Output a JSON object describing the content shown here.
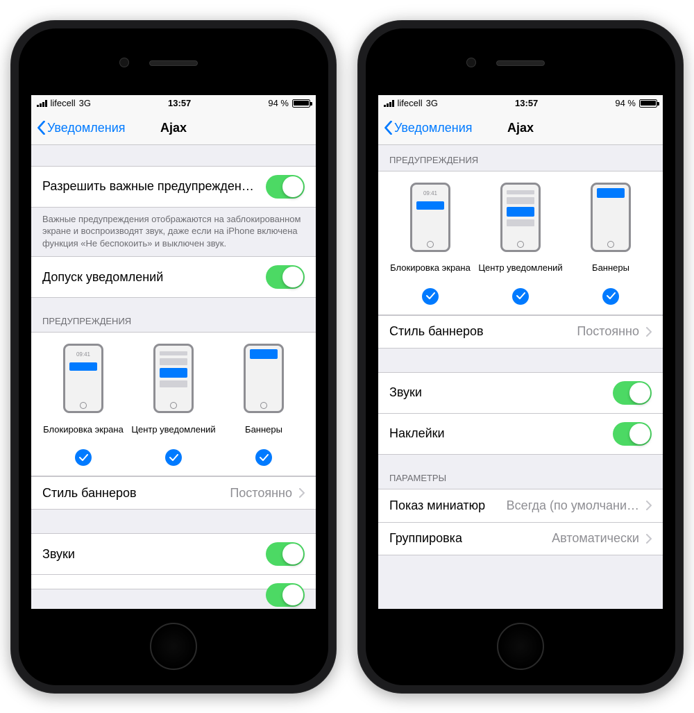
{
  "status": {
    "carrier": "lifecell",
    "network": "3G",
    "time": "13:57",
    "battery_pct": "94 %"
  },
  "nav": {
    "back": "Уведомления",
    "title": "Ajax"
  },
  "left": {
    "critical_label": "Разрешить важные предупрежден…",
    "critical_footer": "Важные предупреждения отображаются на заблокированном экране и воспроизводят звук, даже если на iPhone включена функция «Не беспокоить» и выключен звук.",
    "allow_label": "Допуск уведомлений",
    "alerts_header": "ПРЕДУПРЕЖДЕНИЯ",
    "banner_style_label": "Стиль баннеров",
    "banner_style_value": "Постоянно",
    "sounds_label": "Звуки"
  },
  "right": {
    "alerts_header": "ПРЕДУПРЕЖДЕНИЯ",
    "banner_style_label": "Стиль баннеров",
    "banner_style_value": "Постоянно",
    "sounds_label": "Звуки",
    "badges_label": "Наклейки",
    "options_header": "ПАРАМЕТРЫ",
    "previews_label": "Показ миниатюр",
    "previews_value": "Всегда (по умолчани…",
    "grouping_label": "Группировка",
    "grouping_value": "Автоматически"
  },
  "preview": {
    "time": "09:41",
    "lock": "Блокировка экрана",
    "center": "Центр уведомлений",
    "banner": "Баннеры"
  }
}
